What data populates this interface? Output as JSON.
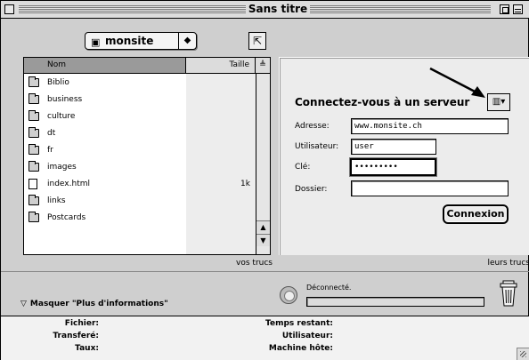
{
  "window": {
    "title": "Sans titre"
  },
  "local": {
    "folder_popup": {
      "label": "monsite",
      "icon": "folder-icon"
    },
    "columns": {
      "name": "Nom",
      "size": "Taille",
      "sort": "≜"
    },
    "files": [
      {
        "name": "Biblio",
        "size": "",
        "kind": "folder"
      },
      {
        "name": "business",
        "size": "",
        "kind": "folder"
      },
      {
        "name": "culture",
        "size": "",
        "kind": "folder"
      },
      {
        "name": "dt",
        "size": "",
        "kind": "folder"
      },
      {
        "name": "fr",
        "size": "",
        "kind": "folder"
      },
      {
        "name": "images",
        "size": "",
        "kind": "folder"
      },
      {
        "name": "index.html",
        "size": "1k",
        "kind": "document"
      },
      {
        "name": "links",
        "size": "",
        "kind": "folder"
      },
      {
        "name": "Postcards",
        "size": "",
        "kind": "folder"
      }
    ],
    "caption": "vos trucs"
  },
  "server": {
    "heading": "Connectez-vous à un serveur",
    "address_label": "Adresse:",
    "address_value": "www.monsite.ch",
    "user_label": "Utilisateur:",
    "user_value": "user",
    "key_label": "Clé:",
    "key_value": "•••••••••",
    "folder_label": "Dossier:",
    "folder_value": "",
    "connect_button": "Connexion",
    "caption": "leurs trucs"
  },
  "status": {
    "text": "Déconnecté.",
    "progress": 0,
    "more_info_toggle": "Masquer \"Plus d'informations\""
  },
  "info": {
    "file_label": "Fichier:",
    "transferred_label": "Transferé:",
    "rate_label": "Taux:",
    "remaining_label": "Temps restant:",
    "user_label": "Utilisateur:",
    "host_label": "Machine hôte:"
  }
}
